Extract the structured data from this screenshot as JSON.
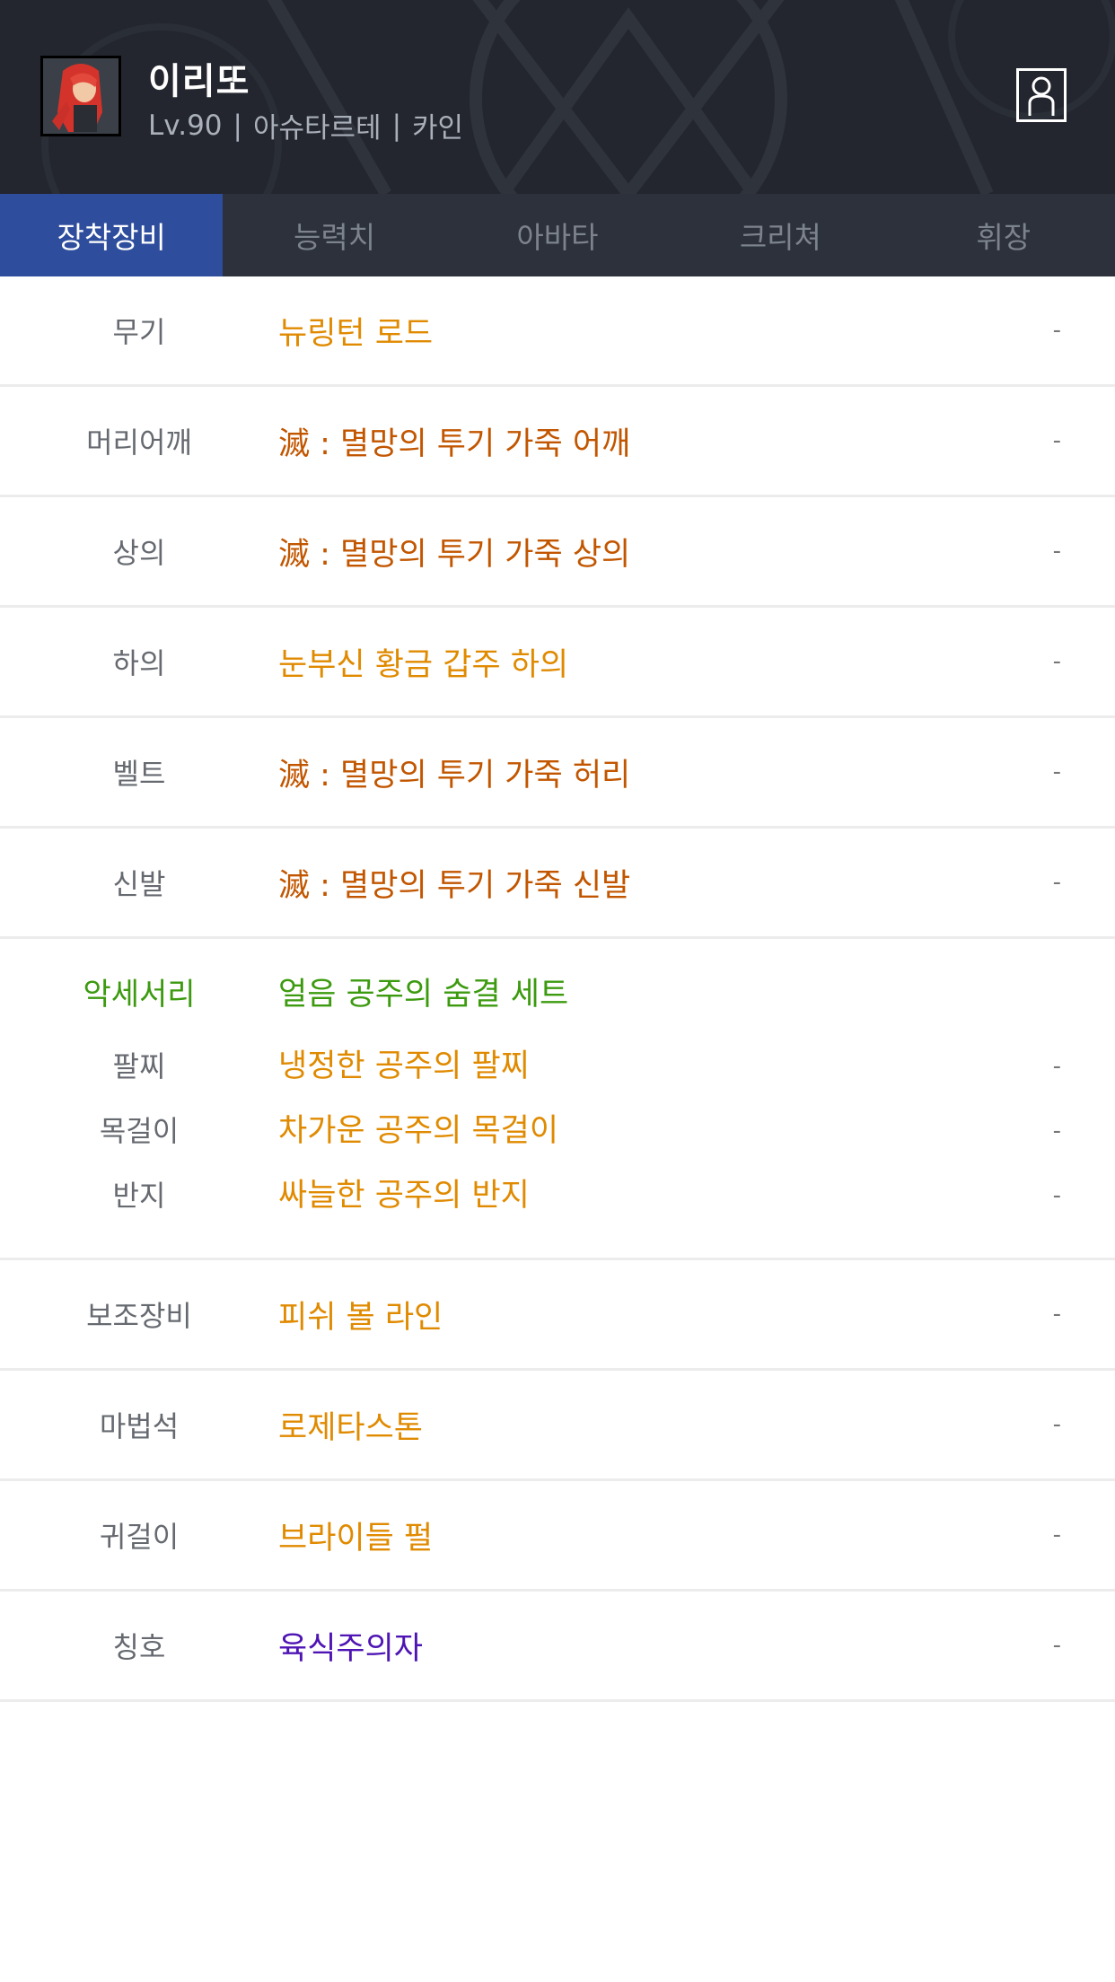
{
  "character": {
    "name": "이리또",
    "level": "Lv.90",
    "server": "아슈타르테",
    "job": "카인",
    "separator": "|"
  },
  "icons": {
    "profile": "profile-icon",
    "avatar": "character-portrait"
  },
  "tabs": [
    {
      "label": "장착장비",
      "active": true
    },
    {
      "label": "능력치",
      "active": false
    },
    {
      "label": "아바타",
      "active": false
    },
    {
      "label": "크리쳐",
      "active": false
    },
    {
      "label": "휘장",
      "active": false
    }
  ],
  "equipment": [
    {
      "slot": "무기",
      "item": "뉴링턴 로드",
      "value": "-"
    },
    {
      "slot": "머리어깨",
      "item": "滅 : 멸망의 투기 가죽 어깨",
      "value": "-"
    },
    {
      "slot": "상의",
      "item": "滅 : 멸망의 투기 가죽 상의",
      "value": "-"
    },
    {
      "slot": "하의",
      "item": "눈부신 황금 갑주 하의",
      "value": "-"
    },
    {
      "slot": "벨트",
      "item": "滅 : 멸망의 투기 가죽 허리",
      "value": "-"
    },
    {
      "slot": "신발",
      "item": "滅 : 멸망의 투기 가죽 신발",
      "value": "-"
    }
  ],
  "accessory": {
    "label": "악세서리",
    "set_name": "얼음 공주의 숨결 세트",
    "items": [
      {
        "slot": "팔찌",
        "item": "냉정한 공주의 팔찌",
        "value": "-"
      },
      {
        "slot": "목걸이",
        "item": "차가운 공주의 목걸이",
        "value": "-"
      },
      {
        "slot": "반지",
        "item": "싸늘한 공주의 반지",
        "value": "-"
      }
    ]
  },
  "extra": [
    {
      "slot": "보조장비",
      "item": "피쉬 볼 라인",
      "value": "-"
    },
    {
      "slot": "마법석",
      "item": "로제타스톤",
      "value": "-"
    },
    {
      "slot": "귀걸이",
      "item": "브라이들 펄",
      "value": "-"
    },
    {
      "slot": "칭호",
      "item": "육식주의자",
      "value": "-"
    }
  ],
  "colors": {
    "unique": "#e08a00",
    "epic": "#c25600",
    "set": "#3c9a0f",
    "title": "#4e14b4",
    "active_tab": "#2e4d9c",
    "header_bg": "#23262e"
  }
}
